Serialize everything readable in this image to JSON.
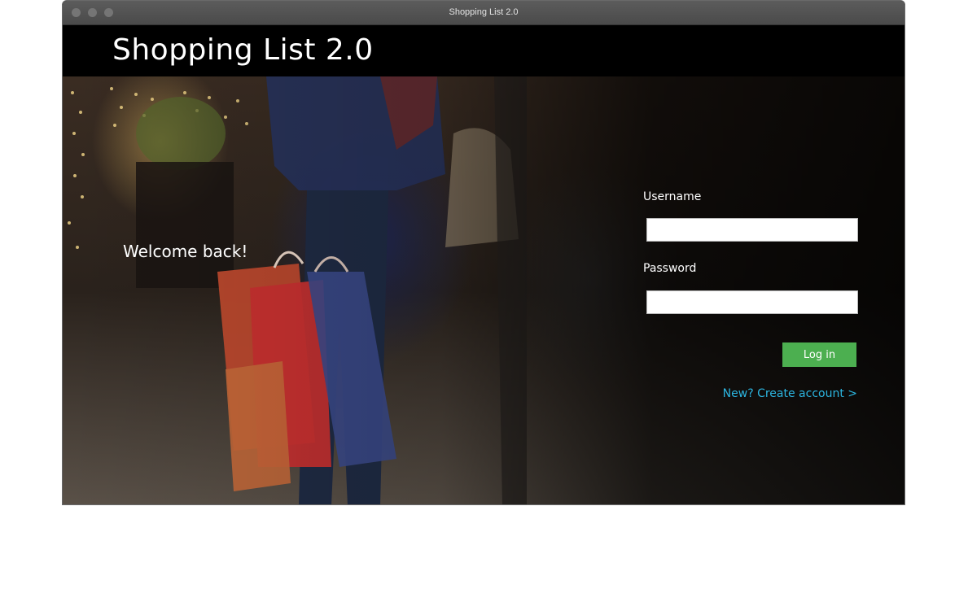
{
  "window": {
    "title": "Shopping List 2.0"
  },
  "header": {
    "app_title": "Shopping List 2.0"
  },
  "hero": {
    "welcome_text": "Welcome back!"
  },
  "login_form": {
    "username_label": "Username",
    "username_value": "",
    "password_label": "Password",
    "password_value": "",
    "login_button_label": "Log in",
    "create_account_link": "New? Create account >"
  },
  "colors": {
    "login_button": "#4caf50",
    "link": "#2cb5e0",
    "header_background": "#000000"
  }
}
